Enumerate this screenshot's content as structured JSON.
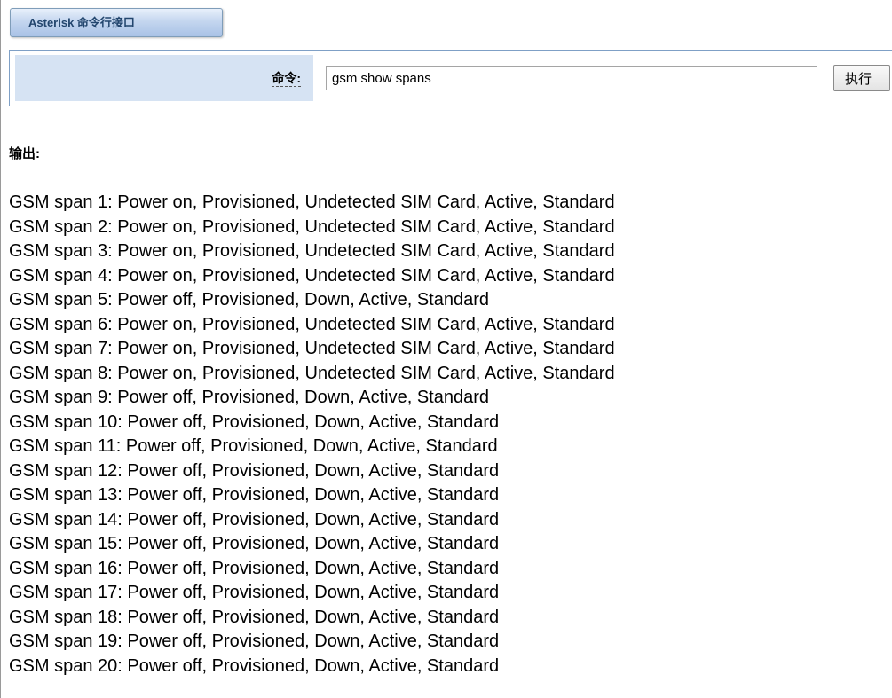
{
  "header": {
    "tab_label": "Asterisk 命令行接口"
  },
  "command": {
    "label": "命令:",
    "input_value": "gsm show spans",
    "execute_label": "执行"
  },
  "output": {
    "label": "输出:",
    "lines": [
      "GSM span 1: Power on, Provisioned, Undetected SIM Card, Active, Standard",
      "GSM span 2: Power on, Provisioned, Undetected SIM Card, Active, Standard",
      "GSM span 3: Power on, Provisioned, Undetected SIM Card, Active, Standard",
      "GSM span 4: Power on, Provisioned, Undetected SIM Card, Active, Standard",
      "GSM span 5: Power off, Provisioned, Down, Active, Standard",
      "GSM span 6: Power on, Provisioned, Undetected SIM Card, Active, Standard",
      "GSM span 7: Power on, Provisioned, Undetected SIM Card, Active, Standard",
      "GSM span 8: Power on, Provisioned, Undetected SIM Card, Active, Standard",
      "GSM span 9: Power off, Provisioned, Down, Active, Standard",
      "GSM span 10: Power off, Provisioned, Down, Active, Standard",
      "GSM span 11: Power off, Provisioned, Down, Active, Standard",
      "GSM span 12: Power off, Provisioned, Down, Active, Standard",
      "GSM span 13: Power off, Provisioned, Down, Active, Standard",
      "GSM span 14: Power off, Provisioned, Down, Active, Standard",
      "GSM span 15: Power off, Provisioned, Down, Active, Standard",
      "GSM span 16: Power off, Provisioned, Down, Active, Standard",
      "GSM span 17: Power off, Provisioned, Down, Active, Standard",
      "GSM span 18: Power off, Provisioned, Down, Active, Standard",
      "GSM span 19: Power off, Provisioned, Down, Active, Standard",
      "GSM span 20: Power off, Provisioned, Down, Active, Standard"
    ]
  }
}
